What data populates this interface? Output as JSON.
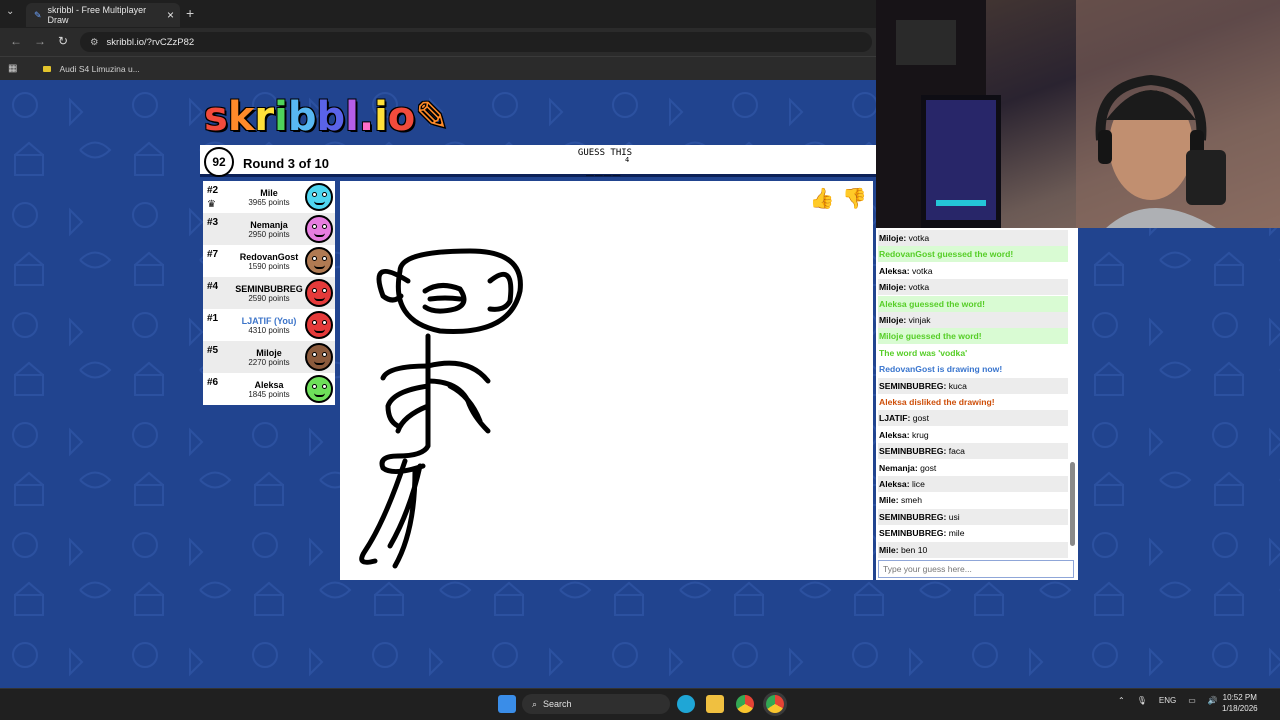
{
  "browser": {
    "tab_title": "skribbl - Free Multiplayer Draw",
    "url": "skribbl.io/?rvCZzP82",
    "bookmark": "Audi S4 Limuzina u..."
  },
  "game": {
    "logo": "skribbl.io",
    "timer": "92",
    "round": "Round 3 of 10",
    "guess_label": "GUESS THIS",
    "letter_count": "4",
    "blanks": "____",
    "chat_placeholder": "Type your guess here..."
  },
  "players": [
    {
      "rank": "#2",
      "name": "Mile",
      "points": "3965 points",
      "color": "#4fd6f0",
      "you": false,
      "alt": false
    },
    {
      "rank": "#3",
      "name": "Nemanja",
      "points": "2950 points",
      "color": "#e77de0",
      "you": false,
      "alt": true
    },
    {
      "rank": "#7",
      "name": "RedovanGost",
      "points": "1590 points",
      "color": "#b07a52",
      "you": false,
      "alt": false
    },
    {
      "rank": "#4",
      "name": "SEMINBUBREG",
      "points": "2590 points",
      "color": "#e53a3a",
      "you": false,
      "alt": true
    },
    {
      "rank": "#1",
      "name": "LJATIF (You)",
      "points": "4310 points",
      "color": "#e53a3a",
      "you": true,
      "alt": false
    },
    {
      "rank": "#5",
      "name": "Miloje",
      "points": "2270 points",
      "color": "#8b5a3c",
      "you": false,
      "alt": true
    },
    {
      "rank": "#6",
      "name": "Aleksa",
      "points": "1845 points",
      "color": "#6ee05a",
      "you": false,
      "alt": false
    }
  ],
  "chat": [
    {
      "name": "Miloje",
      "text": "votka",
      "style": "alt"
    },
    {
      "name": "",
      "text": "RedovanGost guessed the word!",
      "style": "green"
    },
    {
      "name": "Aleksa",
      "text": "votka",
      "style": "normal"
    },
    {
      "name": "Miloje",
      "text": "votka",
      "style": "alt"
    },
    {
      "name": "",
      "text": "Aleksa guessed the word!",
      "style": "green"
    },
    {
      "name": "Miloje",
      "text": "vinjak",
      "style": "alt"
    },
    {
      "name": "",
      "text": "Miloje guessed the word!",
      "style": "green"
    },
    {
      "name": "",
      "text": "The word was 'vodka'",
      "style": "green"
    },
    {
      "name": "",
      "text": "RedovanGost is drawing now!",
      "style": "blue"
    },
    {
      "name": "SEMINBUBREG",
      "text": "kuca",
      "style": "alt"
    },
    {
      "name": "",
      "text": "Aleksa disliked the drawing!",
      "style": "orange"
    },
    {
      "name": "LJATIF",
      "text": "gost",
      "style": "alt"
    },
    {
      "name": "Aleksa",
      "text": "krug",
      "style": "normal"
    },
    {
      "name": "SEMINBUBREG",
      "text": "faca",
      "style": "alt"
    },
    {
      "name": "Nemanja",
      "text": "gost",
      "style": "normal"
    },
    {
      "name": "Aleksa",
      "text": "lice",
      "style": "alt"
    },
    {
      "name": "Mile",
      "text": "smeh",
      "style": "normal"
    },
    {
      "name": "SEMINBUBREG",
      "text": "usi",
      "style": "alt"
    },
    {
      "name": "SEMINBUBREG",
      "text": "mile",
      "style": "normal"
    },
    {
      "name": "Mile",
      "text": "ben 10",
      "style": "alt"
    }
  ],
  "taskbar": {
    "search": "Search",
    "lang": "ENG",
    "time": "10:52 PM",
    "date": "1/18/2026"
  }
}
